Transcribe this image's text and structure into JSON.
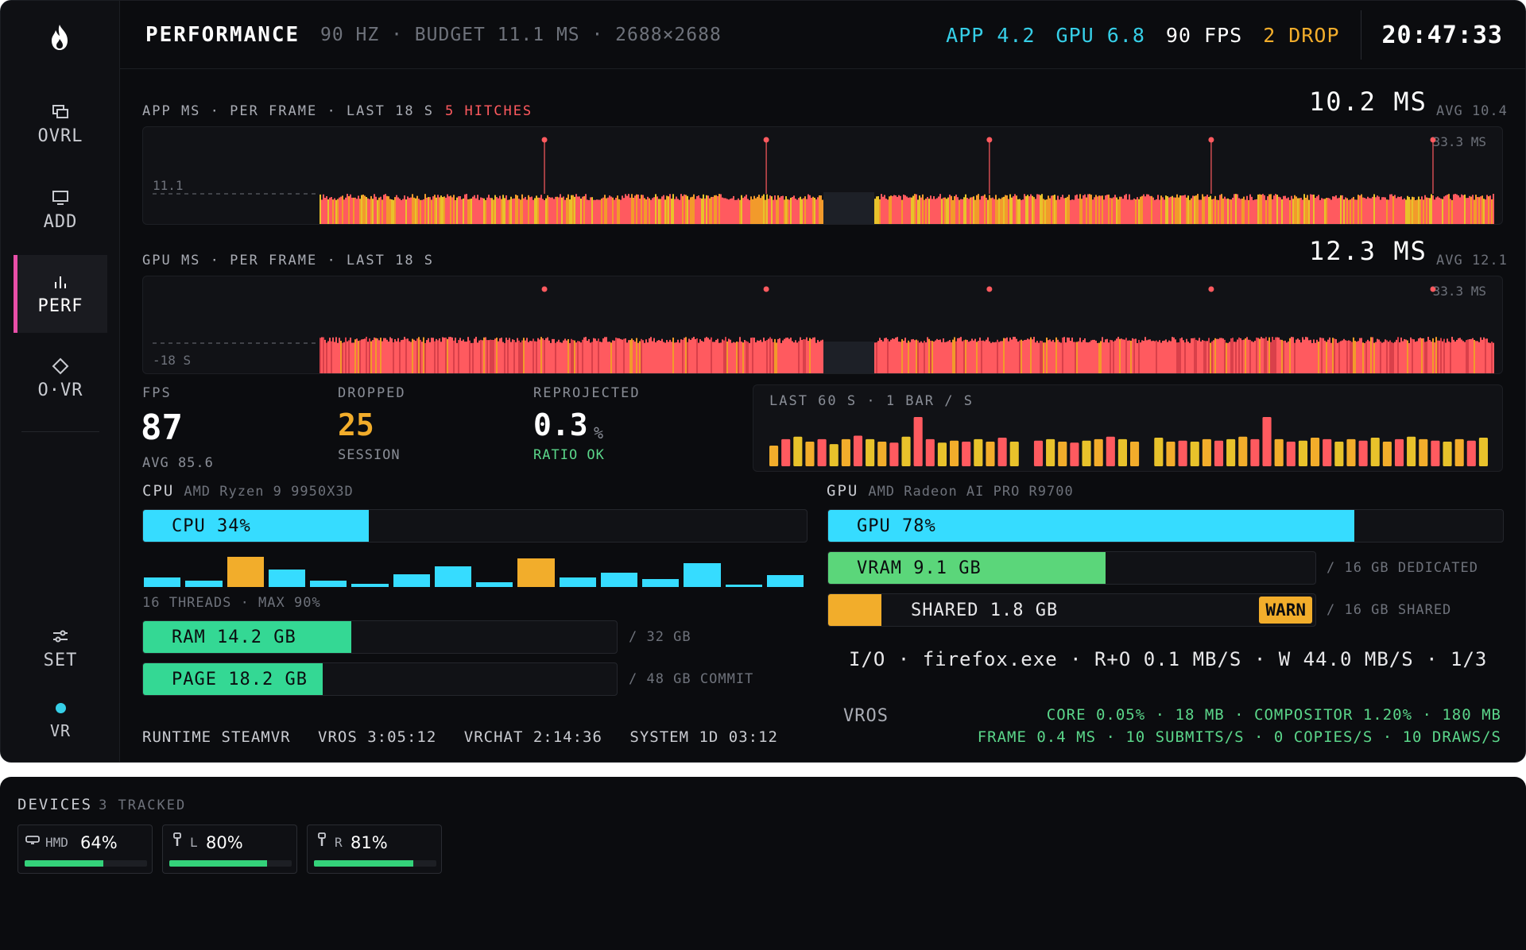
{
  "colors": {
    "accent_pink": "#e84fa8",
    "cyan": "#36cfe8",
    "green": "#5bd68a",
    "amber": "#f2ad2b",
    "red": "#ff5a5f",
    "bar_green": "#34d27a"
  },
  "sidebar": {
    "items": [
      {
        "label": "OVRL",
        "icon": "layers-icon"
      },
      {
        "label": "ADD",
        "icon": "monitor-icon"
      },
      {
        "label": "PERF",
        "icon": "bar-chart-icon",
        "active": true
      },
      {
        "label": "O·VR",
        "icon": "diamond-icon"
      }
    ],
    "settings_label": "SET",
    "vr_label": "VR"
  },
  "header": {
    "title": "PERFORMANCE",
    "meta": "90 HZ · BUDGET 11.1 MS · 2688×2688",
    "app": "APP 4.2",
    "gpu": "GPU 6.8",
    "fps": "90 FPS",
    "drop": "2 DROP",
    "clock": "20:47:33"
  },
  "app_chart": {
    "label": "APP MS · PER FRAME · LAST 18 S",
    "hitches": "5 HITCHES",
    "value": "10.2 MS",
    "avg": "AVG 10.4",
    "ref_top": "33.3 MS",
    "ref_budget": "11.1",
    "hitch_positions": [
      0.295,
      0.458,
      0.622,
      0.785,
      0.948
    ]
  },
  "gpu_chart": {
    "label": "GPU MS · PER FRAME · LAST 18 S",
    "value": "12.3 MS",
    "avg": "AVG 12.1",
    "ref_top": "33.3 MS",
    "ref_left": "-18 S",
    "hitch_positions": [
      0.295,
      0.458,
      0.622,
      0.785,
      0.948
    ]
  },
  "stats": {
    "fps_label": "FPS",
    "fps_value": "87",
    "fps_sub": "AVG 85.6",
    "dropped_label": "DROPPED",
    "dropped_value": "25",
    "dropped_sub": "SESSION",
    "reproj_label": "REPROJECTED",
    "reproj_value": "0.3",
    "reproj_unit": "%",
    "reproj_sub": "RATIO OK"
  },
  "mini_chart": {
    "label": "LAST 60 S · 1 BAR / S",
    "values": [
      0.42,
      0.55,
      0.6,
      0.5,
      0.55,
      0.45,
      0.55,
      0.62,
      0.55,
      0.5,
      0.48,
      0.6,
      1.0,
      0.55,
      0.48,
      0.52,
      0.5,
      0.55,
      0.5,
      0.58,
      0.5,
      0.0,
      0.52,
      0.55,
      0.5,
      0.48,
      0.52,
      0.55,
      0.6,
      0.55,
      0.5,
      0.0,
      0.58,
      0.5,
      0.52,
      0.5,
      0.55,
      0.52,
      0.55,
      0.6,
      0.55,
      1.0,
      0.55,
      0.5,
      0.52,
      0.58,
      0.55,
      0.5,
      0.55,
      0.52,
      0.58,
      0.5,
      0.55,
      0.6,
      0.55,
      0.52,
      0.5,
      0.55,
      0.52,
      0.58
    ]
  },
  "cpu": {
    "label": "CPU",
    "model": "AMD Ryzen 9 9950X3D",
    "bar_label": "CPU 34%",
    "pct": 0.34,
    "threads": [
      0.3,
      0.2,
      0.95,
      0.55,
      0.2,
      0.1,
      0.4,
      0.65,
      0.15,
      0.9,
      0.3,
      0.45,
      0.25,
      0.75,
      0.08,
      0.38
    ],
    "threads_label": "16 THREADS · MAX 90%",
    "ram_label": "RAM 14.2 GB",
    "ram_pct": 0.44,
    "ram_side": "/ 32 GB",
    "page_label": "PAGE 18.2 GB",
    "page_pct": 0.38,
    "page_side": "/ 48 GB COMMIT"
  },
  "gpu": {
    "label": "GPU",
    "model": "AMD Radeon AI PRO R9700",
    "bar_label": "GPU 78%",
    "pct": 0.78,
    "vram_label": "VRAM 9.1 GB",
    "vram_pct": 0.57,
    "vram_side": "/ 16 GB DEDICATED",
    "shared_label": "SHARED 1.8 GB",
    "shared_pct": 0.11,
    "shared_badge": "WARN",
    "shared_side": "/ 16 GB SHARED"
  },
  "io": "I/O · firefox.exe · R+O 0.1 MB/S · W 44.0 MB/S · 1/3",
  "vros": {
    "label": "VROS",
    "line1": "CORE 0.05% · 18 MB · COMPOSITOR 1.20% · 180 MB",
    "line2": "FRAME 0.4 MS · 10 SUBMITS/S · 0 COPIES/S · 10 DRAWS/S"
  },
  "runtime": {
    "runtime": "RUNTIME STEAMVR",
    "vros": "VROS 3:05:12",
    "vrchat": "VRCHAT 2:14:36",
    "system": "SYSTEM 1D 03:12"
  },
  "devices": {
    "title": "DEVICES",
    "tracked": "3 TRACKED",
    "items": [
      {
        "name": "HMD",
        "pct": "64%",
        "level": 0.64,
        "icon": "headset-icon"
      },
      {
        "name": "L",
        "pct": "80%",
        "level": 0.8,
        "icon": "controller-icon"
      },
      {
        "name": "R",
        "pct": "81%",
        "level": 0.81,
        "icon": "controller-icon"
      }
    ]
  }
}
